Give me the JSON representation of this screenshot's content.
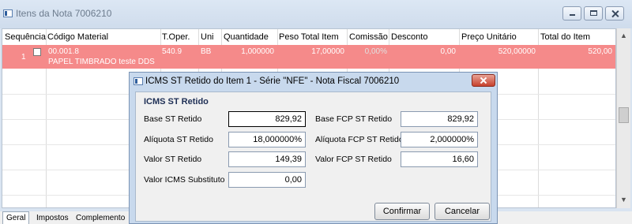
{
  "window": {
    "title": "Itens da Nota 7006210"
  },
  "grid": {
    "columns": [
      "Sequência",
      "Código Material",
      "T.Oper.",
      "Uni",
      "Quantidade",
      "Peso Total Item",
      "Comissão",
      "Desconto",
      "Preço Unitário",
      "Total do Item"
    ],
    "row": {
      "sequence": "1",
      "code": "00.001.8",
      "description": "PAPEL TIMBRADO teste DDS",
      "toper": "540.9",
      "uni": "BB",
      "quantidade": "1,000000",
      "peso_total": "17,00000",
      "comissao": "0,00%",
      "desconto": "0,00",
      "preco_unitario": "520,00000",
      "total_item": "520,00"
    }
  },
  "tabs": [
    "Geral",
    "Impostos",
    "Complemento"
  ],
  "dialog": {
    "title": "ICMS ST Retido do Item 1 - Série \"NFE\" - Nota Fiscal 7006210",
    "group_title": "ICMS ST Retido",
    "fields": {
      "base_st_label": "Base ST Retido",
      "base_st_value": "829,92",
      "base_fcp_label": "Base FCP ST Retido",
      "base_fcp_value": "829,92",
      "aliq_st_label": "Alíquota ST Retido",
      "aliq_st_value": "18,000000%",
      "aliq_fcp_label": "Alíquota FCP ST Retido",
      "aliq_fcp_value": "2,000000%",
      "valor_st_label": "Valor ST Retido",
      "valor_st_value": "149,39",
      "valor_fcp_label": "Valor FCP ST Retido",
      "valor_fcp_value": "16,60",
      "valor_icms_sub_label": "Valor ICMS Substituto",
      "valor_icms_sub_value": "0,00"
    },
    "confirm_label": "Confirmar",
    "cancel_label": "Cancelar"
  }
}
